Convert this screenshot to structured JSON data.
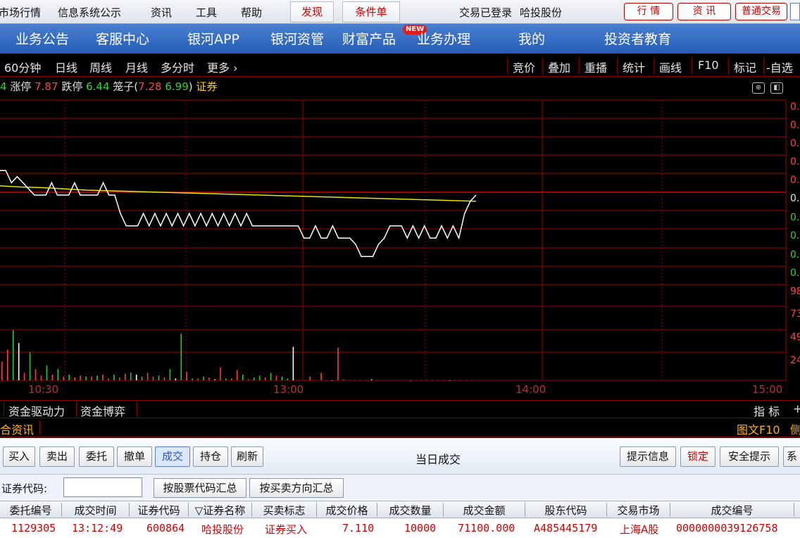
{
  "menubar": {
    "items": [
      "市场行情",
      "信息系统公示",
      "资讯",
      "工具",
      "帮助"
    ],
    "discover": "发现",
    "conditional_order": "条件单",
    "login_status": "交易已登录",
    "broker_user": "哈投股份",
    "chips": [
      "行 情",
      "资 讯",
      "普通交易"
    ]
  },
  "navbar": {
    "items": [
      "业务公告",
      "客服中心",
      "银河APP",
      "银河资管",
      "财富产品",
      "业务办理",
      "我的",
      "投资者教育"
    ],
    "new_badge": "NEW"
  },
  "periodbar": {
    "periods": [
      "60分钟",
      "日线",
      "周线",
      "月线",
      "多分时",
      "更多"
    ],
    "more_arrow": "›",
    "tools": [
      "竞价",
      "叠加",
      "重播",
      "统计",
      "画线",
      "F10",
      "标记",
      "-自选"
    ]
  },
  "info": {
    "prefix": "4",
    "limit_up_label": "涨停",
    "limit_up_value": "7.87",
    "limit_down_label": "跌停",
    "limit_down_value": "6.44",
    "cage_label": "笼子(",
    "cage_low": "7.28",
    "cage_high": "6.99",
    "cage_close": ")",
    "sector": "证券"
  },
  "chart_data": {
    "type": "line",
    "price_axis_labels": [
      "0.",
      "0.",
      "0.",
      "0.",
      "0.",
      "0.",
      "0.",
      "0.",
      "0.",
      "0."
    ],
    "volume_axis_labels": [
      "98",
      "73",
      "49",
      "24"
    ],
    "time_labels": [
      "10:30",
      "13:00",
      "14:00",
      "15:00"
    ],
    "price_line": [
      7.19,
      7.19,
      7.17,
      7.18,
      7.17,
      7.16,
      7.15,
      7.15,
      7.15,
      7.17,
      7.15,
      7.15,
      7.15,
      7.17,
      7.15,
      7.15,
      7.15,
      7.15,
      7.17,
      7.15,
      7.15,
      7.12,
      7.1,
      7.1,
      7.1,
      7.12,
      7.1,
      7.12,
      7.1,
      7.12,
      7.1,
      7.12,
      7.1,
      7.12,
      7.1,
      7.12,
      7.1,
      7.12,
      7.1,
      7.12,
      7.1,
      7.12,
      7.1,
      7.12,
      7.1,
      7.1,
      7.1,
      7.1,
      7.1,
      7.1,
      7.1,
      7.1,
      7.1,
      7.08,
      7.08,
      7.1,
      7.08,
      7.08,
      7.1,
      7.08,
      7.08,
      7.08,
      7.07,
      7.05,
      7.05,
      7.05,
      7.07,
      7.08,
      7.1,
      7.1,
      7.1,
      7.08,
      7.1,
      7.08,
      7.1,
      7.08,
      7.08,
      7.1,
      7.08,
      7.1,
      7.08,
      7.12,
      7.14,
      7.15
    ],
    "avg_line": [
      7.165,
      7.163,
      7.162,
      7.16,
      7.158,
      7.157,
      7.156,
      7.155,
      7.154,
      7.153,
      7.152,
      7.151,
      7.15,
      7.149,
      7.148,
      7.147,
      7.146,
      7.145,
      7.144,
      7.143,
      7.142,
      7.141,
      7.14
    ],
    "volume_bars_up": [
      20,
      33,
      0,
      40,
      8,
      0,
      12,
      5,
      0,
      6,
      0,
      4,
      0,
      3,
      5,
      0,
      4,
      0,
      6,
      2,
      0,
      3,
      7,
      0,
      6,
      0,
      8,
      4,
      0,
      3,
      0,
      2,
      0,
      9,
      0,
      2,
      0,
      3,
      1,
      14,
      0,
      2,
      11,
      0,
      1,
      0,
      0,
      3,
      0,
      5,
      0,
      0,
      36,
      0,
      0,
      4,
      0,
      8,
      0,
      0,
      35,
      1,
      0,
      0,
      0,
      0,
      1,
      0,
      0,
      0,
      0,
      0,
      0,
      0,
      0,
      0,
      0,
      0,
      0,
      0,
      0,
      0,
      0,
      0,
      0
    ],
    "volume_bars_down": [
      0,
      0,
      54,
      0,
      0,
      30,
      0,
      0,
      16,
      0,
      12,
      0,
      6,
      0,
      0,
      4,
      0,
      5,
      0,
      0,
      6,
      0,
      0,
      8,
      0,
      4,
      0,
      0,
      5,
      0,
      12,
      0,
      50,
      0,
      2,
      0,
      4,
      0,
      0,
      0,
      2,
      0,
      0,
      6,
      0,
      3,
      5,
      0,
      8,
      0,
      4,
      2,
      0,
      0,
      0,
      0,
      0,
      0,
      0,
      0,
      0,
      0,
      0,
      0,
      0,
      0,
      0,
      0,
      0,
      0,
      0,
      0,
      0,
      0,
      0,
      0,
      0,
      0,
      0,
      0,
      0,
      0,
      0,
      0,
      0
    ],
    "colors": {
      "price": "#ffffff",
      "avg": "#e6e600",
      "grid": "#a00000",
      "up": "#ff3b3b",
      "down": "#22cc22"
    }
  },
  "tabs": {
    "items": [
      "资金驱动力",
      "资金博弈"
    ],
    "right": [
      "指 标",
      "+"
    ]
  },
  "news": {
    "left": "合资讯",
    "right": [
      "图文F10",
      "侧"
    ]
  },
  "toolbar": {
    "buttons": [
      "买入",
      "卖出",
      "委托",
      "撤单",
      "成交",
      "持仓",
      "刷新"
    ],
    "title": "当日成交",
    "right_buttons": [
      "提示信息",
      "锁定",
      "安全提示",
      "系"
    ]
  },
  "filter": {
    "code_label": "证券代码:",
    "code_value": "",
    "btn_by_code": "按股票代码汇总",
    "btn_by_side": "按买卖方向汇总"
  },
  "grid": {
    "columns": [
      "委托编号",
      "成交时间",
      "证券代码",
      "▽证券名称",
      "买卖标志",
      "成交价格",
      "成交数量",
      "成交金额",
      "股东代码",
      "交易市场",
      "成交编号"
    ],
    "row": {
      "order_no": "1129305",
      "time": "13:12:49",
      "code": "600864",
      "name": "哈投股份",
      "side": "证券买入",
      "price": "7.110",
      "qty": "10000",
      "amount": "71100.000",
      "holder": "A485445179",
      "market": "上海A股",
      "deal_no": "0000000039126758"
    }
  }
}
